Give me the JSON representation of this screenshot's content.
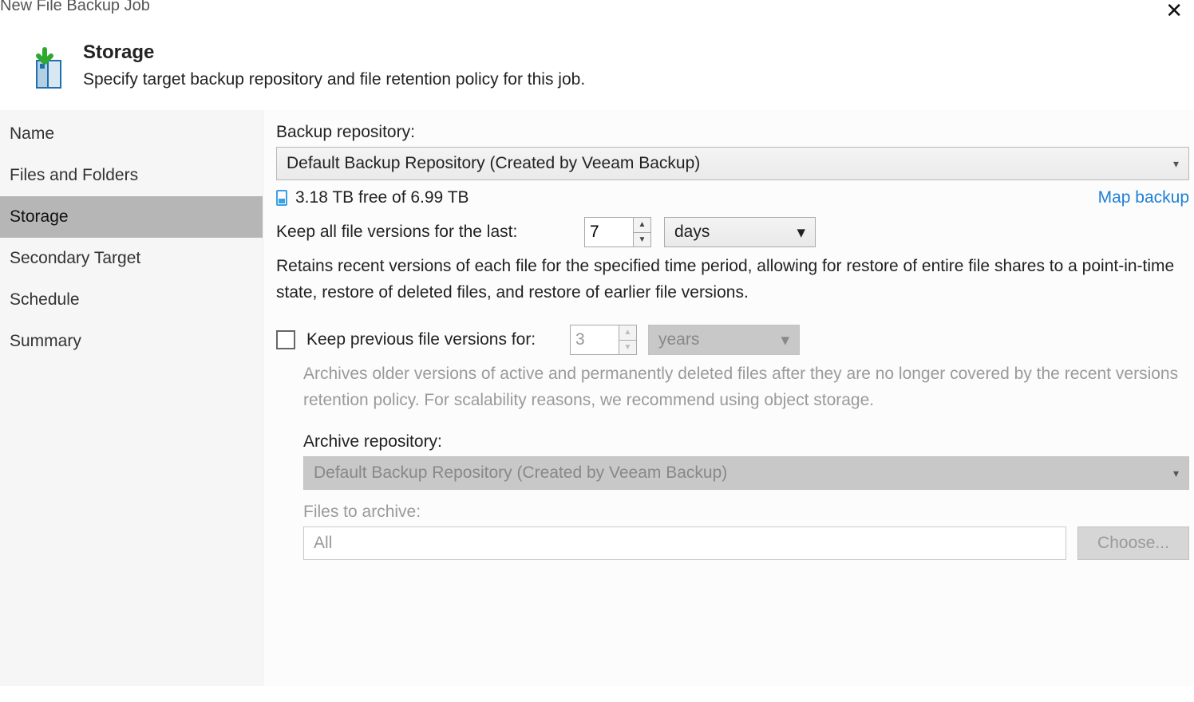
{
  "window": {
    "title": "New File Backup Job"
  },
  "header": {
    "heading": "Storage",
    "subheading": "Specify target backup repository and file retention policy for this job."
  },
  "sidebar": {
    "items": [
      {
        "label": "Name"
      },
      {
        "label": "Files and Folders"
      },
      {
        "label": "Storage"
      },
      {
        "label": "Secondary Target"
      },
      {
        "label": "Schedule"
      },
      {
        "label": "Summary"
      }
    ],
    "selected_index": 2
  },
  "main": {
    "backup_repo_label": "Backup repository:",
    "backup_repo_value": "Default Backup Repository (Created by Veeam Backup)",
    "free_space": "3.18 TB free of 6.99 TB",
    "map_backup": "Map backup",
    "keep_all_label": "Keep all file versions for the last:",
    "keep_all_value": "7",
    "keep_all_unit": "days",
    "keep_all_desc": "Retains recent versions of each file for the specified time period, allowing for restore of entire file shares to a point-in-time state, restore of deleted files, and restore of earlier file versions.",
    "keep_prev_label": "Keep previous file versions for:",
    "keep_prev_value": "3",
    "keep_prev_unit": "years",
    "keep_prev_desc": "Archives older versions of active and permanently deleted files after they are no longer covered by the recent versions retention policy. For scalability reasons, we recommend using object storage.",
    "archive_repo_label": "Archive repository:",
    "archive_repo_value": "Default Backup Repository (Created by Veeam Backup)",
    "files_to_archive_label": "Files to archive:",
    "files_to_archive_value": "All",
    "choose_btn": "Choose..."
  }
}
